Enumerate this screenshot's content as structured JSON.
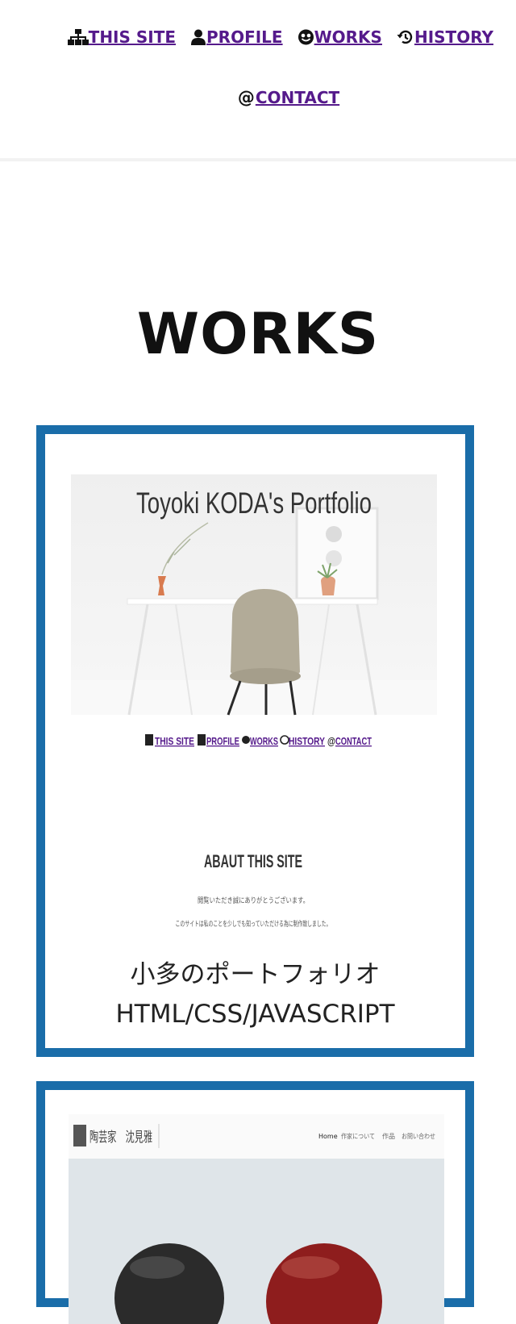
{
  "nav": {
    "items": [
      {
        "label": "THIS SITE",
        "icon": "sitemap-icon"
      },
      {
        "label": "PROFILE",
        "icon": "user-icon"
      },
      {
        "label": "WORKS",
        "icon": "face-icon"
      },
      {
        "label": "HISTORY",
        "icon": "history-icon"
      },
      {
        "label": "CONTACT",
        "icon": "at-icon",
        "glyph": "@"
      }
    ],
    "link_color": "#551a8b"
  },
  "main": {
    "title": "WORKS",
    "card_border_color": "#1a6da9"
  },
  "works": [
    {
      "screenshot": {
        "heading": "Toyoki KODA's Portfolio",
        "nav_items": [
          "THIS SITE",
          "PROFILE",
          "WORKS",
          "HISTORY",
          "CONTACT"
        ],
        "section_title": "ABAUT THIS SITE",
        "text_lines": [
          "閲覧いただき誠にありがとうございます。",
          "このサイトは私のことを少しでも知っていただける為に制作致しました。"
        ]
      },
      "caption_line1": "小多のポートフォリオ",
      "caption_line2": "HTML/CSS/JAVASCRIPT"
    },
    {
      "screenshot": {
        "brand": "陶芸家　沈見雅",
        "nav_items": [
          "Home",
          "作家について",
          "作品",
          "お問い合わせ"
        ]
      }
    }
  ]
}
